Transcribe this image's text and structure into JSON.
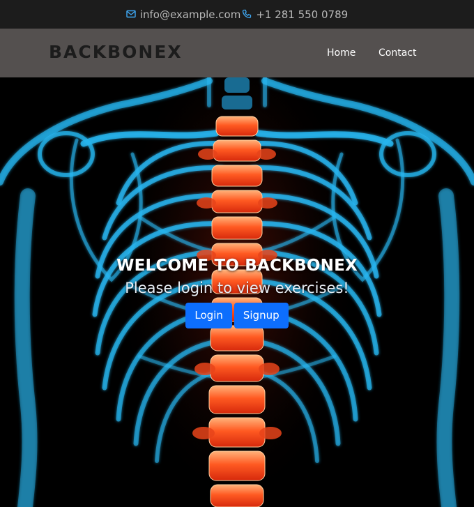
{
  "topbar": {
    "email": "info@example.com",
    "phone": "+1 281 550 0789",
    "icon_color": "#3fa9f5"
  },
  "navbar": {
    "brand": "BACKBONEX",
    "links": [
      "Home",
      "Contact"
    ],
    "background": "#54504f"
  },
  "hero": {
    "title": "WELCOME TO BACKBONEX",
    "subtitle": "Please login to view exercises!",
    "buttons": {
      "login": "Login",
      "signup": "Signup"
    },
    "button_color": "#0d6efd",
    "image": {
      "subject": "x-ray skeleton torso with highlighted spine",
      "bone_color": "#27b6f0",
      "spine_color": "#ff4a1c"
    }
  }
}
